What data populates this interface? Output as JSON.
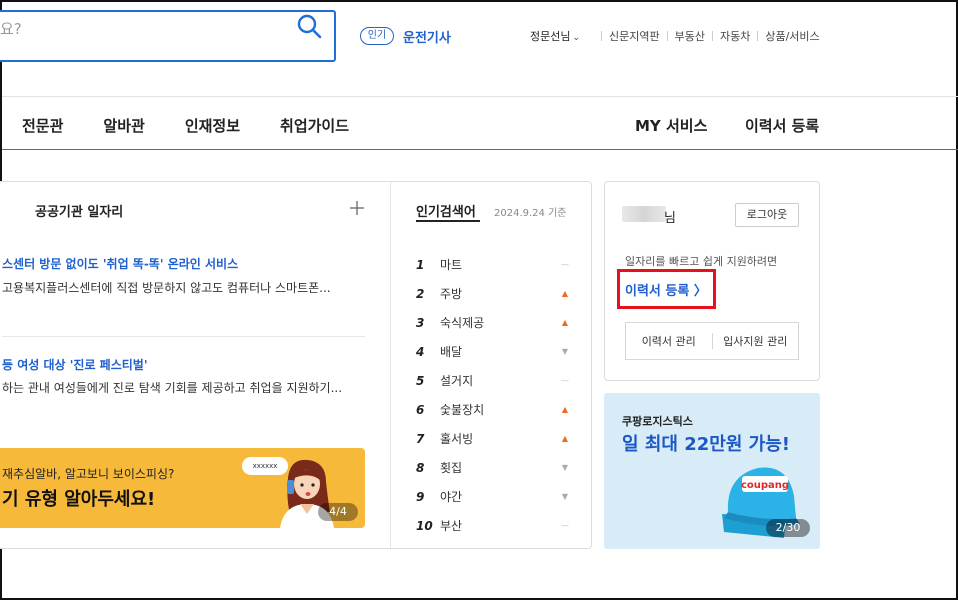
{
  "header": {
    "search_placeholder": "요?",
    "popular_badge": "인기",
    "popular_term": "운전기사",
    "user_menu": "정문선님",
    "top_links": [
      "신문지역판",
      "부동산",
      "자동차",
      "상품/서비스"
    ]
  },
  "nav": {
    "left": [
      "전문관",
      "알바관",
      "인재정보",
      "취업가이드"
    ],
    "right": [
      "MY 서비스",
      "이력서 등록"
    ]
  },
  "public_jobs": {
    "title": "공공기관 일자리",
    "news": [
      {
        "title": "스센터 방문 없이도 '취업 똑-똑' 온라인 서비스",
        "desc": "고용복지플러스센터에 직접 방문하지 않고도 컴퓨터나 스마트폰..."
      },
      {
        "title": "등 여성 대상 '진로 페스티벌'",
        "desc": "하는 관내 여성들에게 진로 탐색 기회를 제공하고 취업을 지원하기..."
      }
    ],
    "banner": {
      "line1": "재추심알바, 알고보니 보이스피싱?",
      "line2": "기 유형 알아두세요!",
      "bubble": "xxxxxx",
      "counter": "4/4"
    }
  },
  "popular_keywords": {
    "title": "인기검색어",
    "date": "2024.9.24 기준",
    "items": [
      {
        "rank": "1",
        "term": "마트",
        "trend": "same"
      },
      {
        "rank": "2",
        "term": "주방",
        "trend": "up"
      },
      {
        "rank": "3",
        "term": "숙식제공",
        "trend": "up"
      },
      {
        "rank": "4",
        "term": "배달",
        "trend": "down"
      },
      {
        "rank": "5",
        "term": "설거지",
        "trend": "same"
      },
      {
        "rank": "6",
        "term": "숯불장치",
        "trend": "up"
      },
      {
        "rank": "7",
        "term": "홀서빙",
        "trend": "up"
      },
      {
        "rank": "8",
        "term": "횟집",
        "trend": "down"
      },
      {
        "rank": "9",
        "term": "야간",
        "trend": "down"
      },
      {
        "rank": "10",
        "term": "부산",
        "trend": "same"
      }
    ]
  },
  "user_card": {
    "name_suffix": "님",
    "logout": "로그아웃",
    "message": "일자리를 빠르고 쉽게 지원하려면",
    "resume_link": "이력서 등록 〉",
    "buttons": [
      "이력서 관리",
      "입사지원 관리"
    ]
  },
  "ad": {
    "brand": "쿠팡로지스틱스",
    "title": "일 최대 22만원 가능!",
    "cap_text": "coupang",
    "counter": "2/30"
  },
  "colors": {
    "accent_blue": "#1f5fcf",
    "highlight_red": "#e8101a",
    "banner_yellow": "#f7b93a",
    "ad_bg": "#d7ecf6",
    "trend_up": "#f06a1d"
  }
}
